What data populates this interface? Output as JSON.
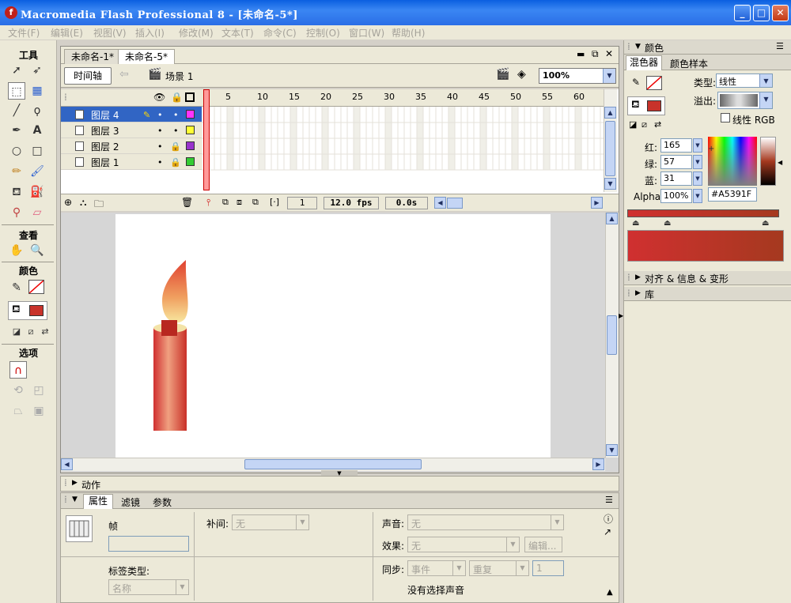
{
  "window": {
    "title": "Macromedia Flash Professional 8 - [未命名-5*]",
    "minimize": "_",
    "maximize": "□",
    "close": "✕"
  },
  "menu": [
    "文件(F)",
    "编辑(E)",
    "视图(V)",
    "插入(I)",
    "修改(M)",
    "文本(T)",
    "命令(C)",
    "控制(O)",
    "窗口(W)",
    "帮助(H)"
  ],
  "tools": {
    "title": "工具",
    "view_label": "查看",
    "color_label": "颜色",
    "options_label": "选项",
    "text_tool": "A"
  },
  "document": {
    "tabs": [
      "未命名-1*",
      "未命名-5*"
    ],
    "active_tab": 1,
    "timeline_button": "时间轴",
    "scene_label": "场景 1",
    "zoom": "100%"
  },
  "timeline": {
    "layers": [
      {
        "name": "图层 4",
        "locked": false,
        "color": "#ff33ff",
        "selected": true
      },
      {
        "name": "图层 3",
        "locked": false,
        "color": "#ffff33",
        "selected": false
      },
      {
        "name": "图层 2",
        "locked": true,
        "color": "#9933cc",
        "selected": false
      },
      {
        "name": "图层 1",
        "locked": true,
        "color": "#33cc33",
        "selected": false
      }
    ],
    "ruler_ticks": [
      "1",
      "5",
      "10",
      "15",
      "20",
      "25",
      "30",
      "35",
      "40",
      "45",
      "50",
      "55",
      "60"
    ],
    "current_frame": "1",
    "fps": "12.0 fps",
    "time": "0.0s"
  },
  "panels": {
    "actions": "动作",
    "properties_tabs": [
      "属性",
      "滤镜",
      "参数"
    ],
    "frame_label": "帧",
    "tween_label": "补间:",
    "tween_value": "无",
    "sound_label": "声音:",
    "sound_value": "无",
    "effect_label": "效果:",
    "effect_value": "无",
    "edit_button": "编辑...",
    "label_type_label": "标签类型:",
    "label_type_value": "名称",
    "sync_label": "同步:",
    "sync_value": "事件",
    "repeat_value": "重复",
    "repeat_count": "1",
    "no_sound": "没有选择声音"
  },
  "color_panel": {
    "title": "颜色",
    "tabs": [
      "混色器",
      "颜色样本"
    ],
    "type_label": "类型:",
    "type_value": "线性",
    "overflow_label": "溢出:",
    "linear_rgb": "线性 RGB",
    "red_label": "红:",
    "red": "165",
    "green_label": "绿:",
    "green": "57",
    "blue_label": "蓝:",
    "blue": "31",
    "alpha_label": "Alpha:",
    "alpha": "100%",
    "hex": "#A5391F",
    "fill_color": "#c8322a",
    "gradient_start": "#d03030",
    "gradient_end": "#a5391f"
  },
  "collapsed_panels": [
    "对齐 & 信息 & 变形",
    "库"
  ]
}
